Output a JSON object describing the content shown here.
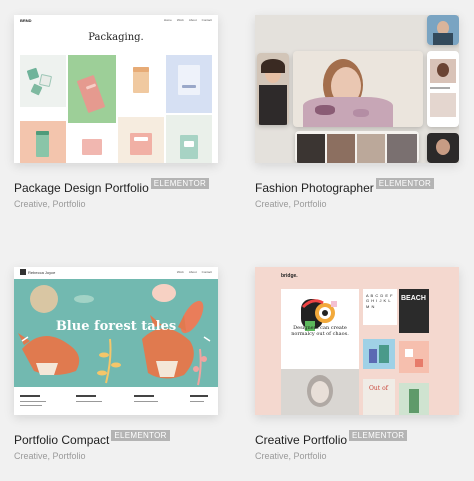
{
  "cards": [
    {
      "title": "Package Design Portfolio",
      "badge": "ELEMENTOR",
      "categories": [
        "Creative",
        "Portfolio"
      ],
      "separator": ",",
      "preview": {
        "logo": "BRND",
        "menu": [
          "Home",
          "Work",
          "About",
          "Contact"
        ],
        "heading": "Packaging."
      }
    },
    {
      "title": "Fashion Photographer",
      "badge": "ELEMENTOR",
      "categories": [
        "Creative",
        "Portfolio"
      ],
      "separator": ","
    },
    {
      "title": "Portfolio Compact",
      "badge": "ELEMENTOR",
      "categories": [
        "Creative",
        "Portfolio"
      ],
      "separator": ",",
      "preview": {
        "logo": "Rebecca Joyce",
        "menu": [
          "Work",
          "About",
          "Contact"
        ],
        "heading": "Blue forest tales"
      }
    },
    {
      "title": "Creative Portfolio",
      "badge": "ELEMENTOR",
      "categories": [
        "Creative",
        "Portfolio"
      ],
      "separator": ",",
      "preview": {
        "logo": "bridge.",
        "headline": "Designers can create normalcy out of chaos.",
        "letters": "A B C D E F G H I J K L M N",
        "beach": "BEACH"
      }
    }
  ],
  "colors": {
    "page_bg": "#f1f1f1",
    "badge_bg": "#b4b4b4",
    "title": "#222222",
    "categories": "#9a9a9a"
  }
}
